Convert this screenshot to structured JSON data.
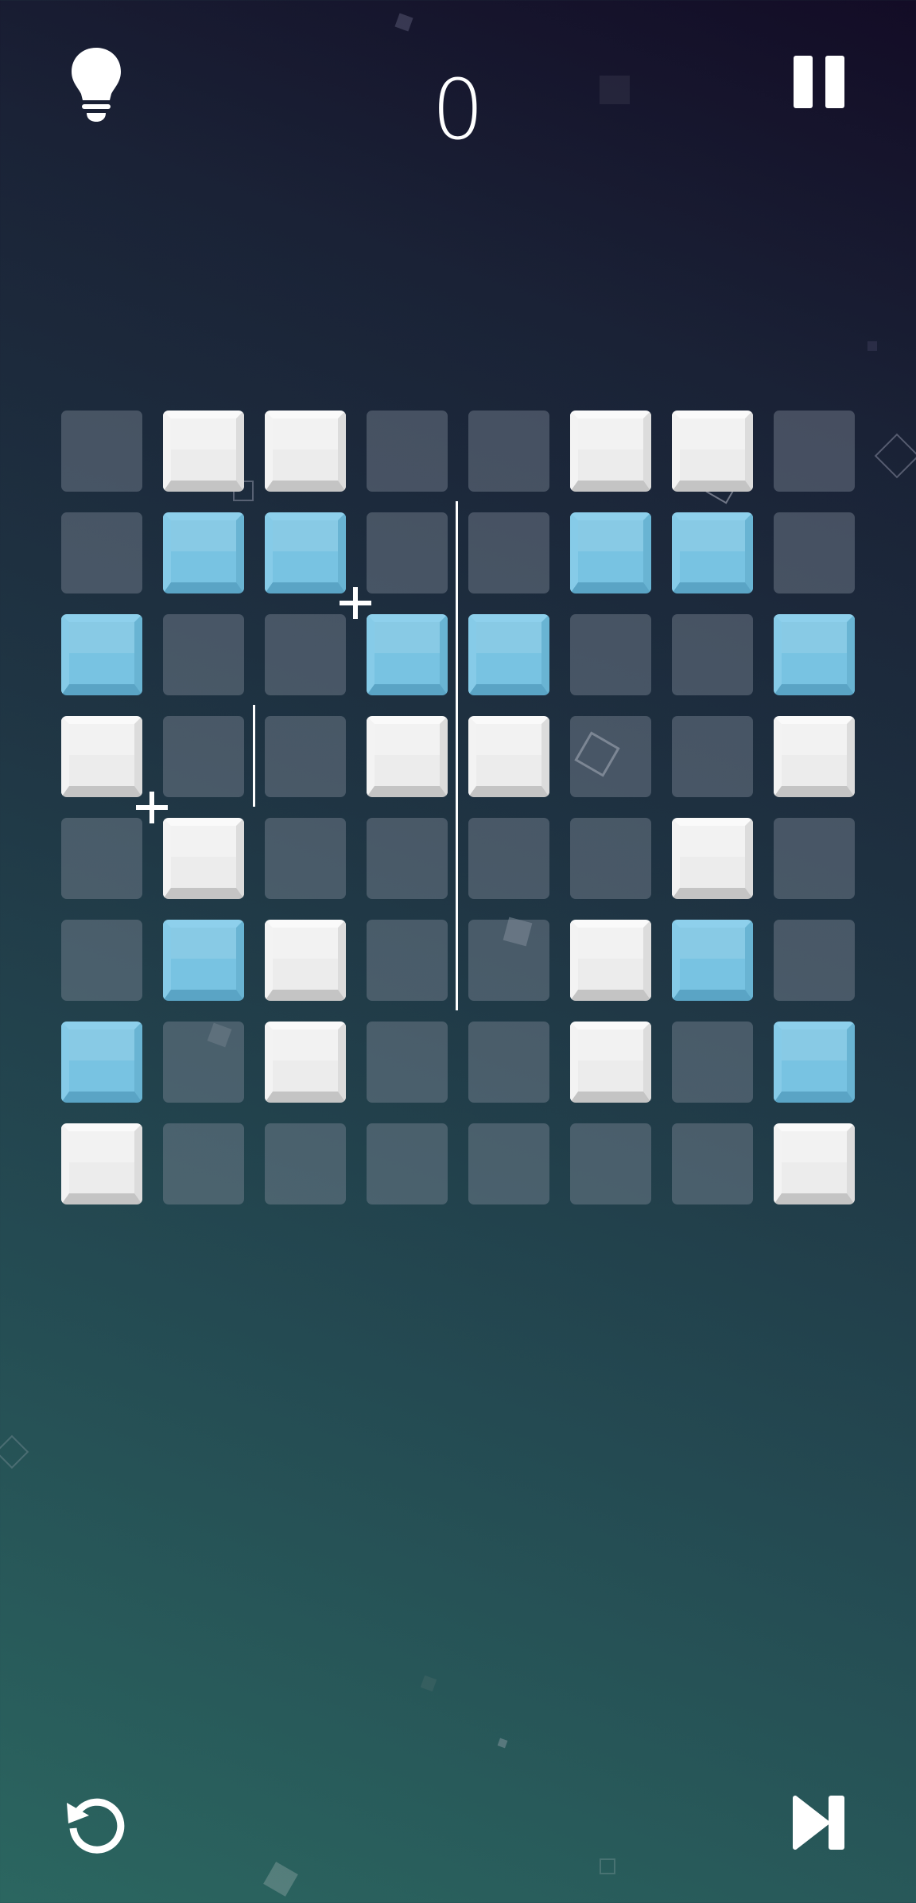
{
  "score": "0",
  "icons": {
    "hint": "lightbulb-icon",
    "pause": "pause-icon",
    "restart": "restart-icon",
    "skip": "skip-icon"
  },
  "colors": {
    "white_tile": "#ececec",
    "blue_tile": "#78c3e2",
    "empty_tile": "#6e7886"
  },
  "board": {
    "rows": 8,
    "cols": 8,
    "cells": [
      [
        "E",
        "W",
        "W",
        "E",
        "E",
        "W",
        "W",
        "E"
      ],
      [
        "E",
        "B",
        "B",
        "E",
        "E",
        "B",
        "B",
        "E"
      ],
      [
        "B",
        "E",
        "E",
        "B",
        "B",
        "E",
        "E",
        "B"
      ],
      [
        "W",
        "E",
        "E",
        "W",
        "W",
        "E",
        "E",
        "W"
      ],
      [
        "E",
        "W",
        "E",
        "E",
        "E",
        "E",
        "W",
        "E"
      ],
      [
        "E",
        "B",
        "W",
        "E",
        "E",
        "W",
        "B",
        "E"
      ],
      [
        "B",
        "E",
        "W",
        "E",
        "E",
        "W",
        "E",
        "B"
      ],
      [
        "W",
        "E",
        "E",
        "E",
        "E",
        "E",
        "E",
        "W"
      ]
    ]
  }
}
